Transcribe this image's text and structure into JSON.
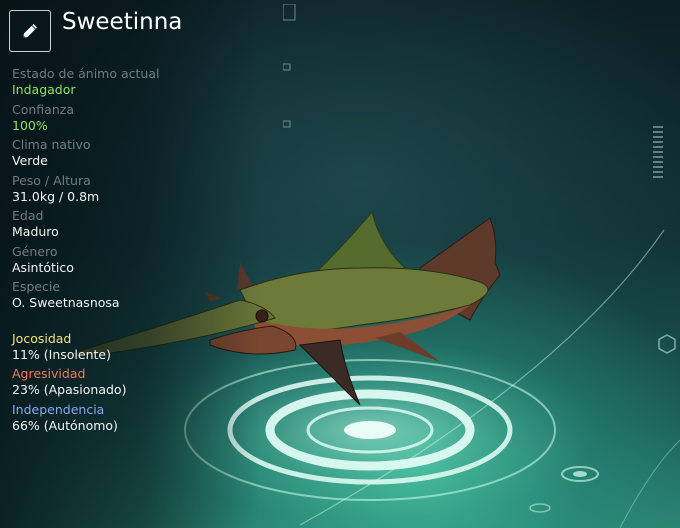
{
  "creature": {
    "name": "Sweetinna"
  },
  "stats": [
    {
      "label": "Estado de ánimo actual",
      "value": "Indagador",
      "value_color": "#8fe35a"
    },
    {
      "label": "Confianza",
      "value": "100%",
      "value_color": "#8fe35a"
    },
    {
      "label": "Clima nativo",
      "value": "Verde"
    },
    {
      "label": "Peso / Altura",
      "value": "31.0kg / 0.8m"
    },
    {
      "label": "Edad",
      "value": "Maduro"
    },
    {
      "label": "Género",
      "value": "Asintótico"
    },
    {
      "label": "Especie",
      "value": "O. Sweetnasnosa"
    }
  ],
  "traits": [
    {
      "label": "Jocosidad",
      "value": "11% (Insolente)",
      "label_color": "#f0e27a"
    },
    {
      "label": "Agresividad",
      "value": "23% (Apasionado)",
      "label_color": "#f07a5a"
    },
    {
      "label": "Independencia",
      "value": "66% (Autónomo)",
      "label_color": "#8aa6f0"
    }
  ],
  "icons": {
    "edit": "pencil-icon"
  }
}
